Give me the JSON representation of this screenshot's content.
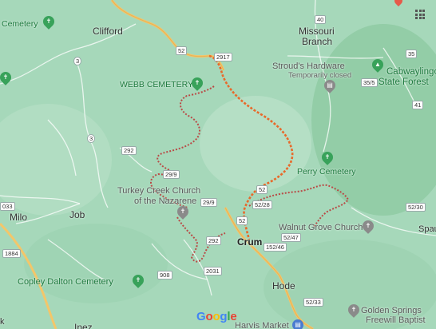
{
  "places": {
    "clifford": "Clifford",
    "missouri_branch_1": "Missouri",
    "missouri_branch_2": "Branch",
    "milo": "Milo",
    "job": "Job",
    "crum": "Crum",
    "hode": "Hode",
    "inez": "Inez",
    "spaul": "Spaul"
  },
  "pois": {
    "cemetery_top": "Cemetery",
    "webb_cemetery": "WEBB CEMETERY",
    "strouds_hardware": "Stroud's Hardware",
    "strouds_status": "Temporarily closed",
    "cabwaylingo_1": "Cabwaylingo",
    "cabwaylingo_2": "State Forest",
    "perry_cemetery": "Perry Cemetery",
    "turkey_creek_1": "Turkey Creek Church",
    "turkey_creek_2": "of the Nazarene",
    "walnut_grove": "Walnut Grove Church",
    "copley_dalton": "Copley Dalton Cemetery",
    "golden_springs_1": "Golden Springs",
    "golden_springs_2": "Freewill Baptist",
    "harvis_market": "Harvis Market"
  },
  "routes": {
    "r2917": "2917",
    "r52a": "52",
    "r40": "40",
    "r35": "35",
    "r35_5": "35/5",
    "r41": "41",
    "r3a": "3",
    "r3b": "3",
    "r292a": "292",
    "r29_9a": "29/9",
    "r29_9b": "29/9",
    "r52b": "52",
    "r52_28": "52/28",
    "r52c": "52",
    "r52_47": "52/47",
    "r152_46": "152/46",
    "r52_30": "52/30",
    "r292b": "292",
    "r2031": "2031",
    "r908": "908",
    "r52_33": "52/33",
    "r1884": "1884",
    "r033": "033"
  },
  "edge_letters": {
    "left_k": "k"
  },
  "brand": {
    "g": "G",
    "o1": "o",
    "o2": "o",
    "g2": "g",
    "l": "l",
    "e": "e"
  },
  "icons": {
    "apps": "grid-icon",
    "cemetery": "cemetery-pin-icon",
    "church": "church-pin-icon",
    "store": "shop-pin-icon"
  },
  "colors": {
    "terrain": "#a3d7b8",
    "route_highlight": "#e8692a",
    "route_dotted": "#c0504d",
    "highway": "#f3c66a"
  }
}
